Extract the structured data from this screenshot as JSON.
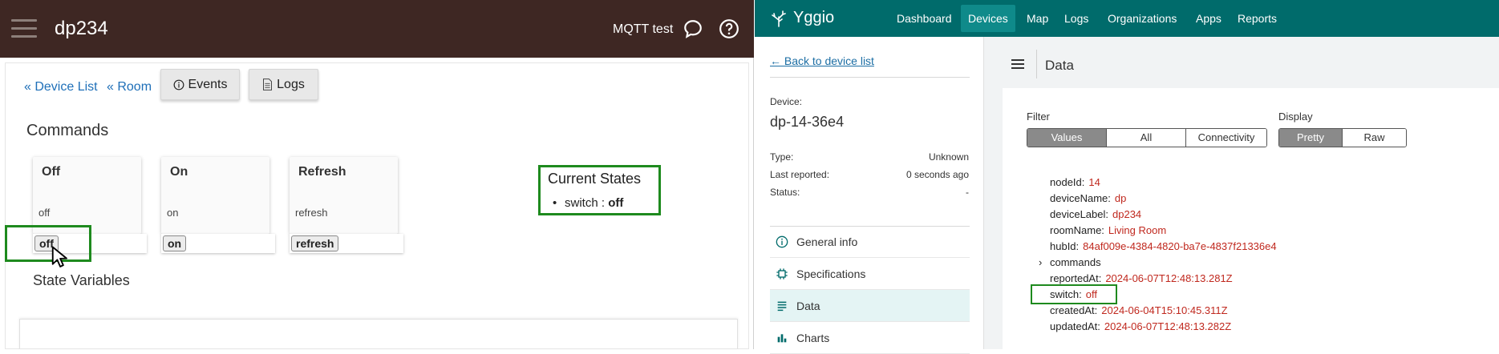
{
  "left_app": {
    "title": "dp234",
    "connection_label": "MQTT test",
    "nav": {
      "device_list": "« Device List",
      "room": "« Room"
    },
    "buttons": {
      "events": "Events",
      "logs": "Logs"
    },
    "commands_title": "Commands",
    "commands": [
      {
        "name": "Off",
        "description": "off",
        "button": "off"
      },
      {
        "name": "On",
        "description": "on",
        "button": "on"
      },
      {
        "name": "Refresh",
        "description": "refresh",
        "button": "refresh"
      }
    ],
    "current_states": {
      "title": "Current States",
      "items": [
        {
          "key": "switch",
          "sep": " : ",
          "value": "off"
        }
      ]
    },
    "state_variables_title": "State Variables",
    "icons": {
      "menu": "hamburger-menu-icon",
      "chat": "chat-bubble-icon",
      "help": "help-circle-icon",
      "events": "info-icon",
      "logs": "document-icon",
      "cursor": "mouse-pointer-icon"
    },
    "colors": {
      "topbar": "#3e2723",
      "link": "#1e6fb8",
      "highlight": "#1e8a1e"
    }
  },
  "right_app": {
    "brand": "Yggio",
    "nav_items": [
      "Dashboard",
      "Devices",
      "Map",
      "Logs",
      "Organizations",
      "Apps",
      "Reports"
    ],
    "active_nav": "Devices",
    "back_link": "← Back to device list",
    "device_label": "Device:",
    "device_name": "dp-14-36e4",
    "info": [
      {
        "key": "Type:",
        "value": "Unknown"
      },
      {
        "key": "Last reported:",
        "value": "0 seconds ago"
      },
      {
        "key": "Status:",
        "value": "-"
      }
    ],
    "side_menu": [
      {
        "label": "General info",
        "icon": "info-icon"
      },
      {
        "label": "Specifications",
        "icon": "chip-icon"
      },
      {
        "label": "Data",
        "icon": "data-lines-icon",
        "active": true
      },
      {
        "label": "Charts",
        "icon": "bar-chart-icon"
      }
    ],
    "data_header": "Data",
    "filter": {
      "label": "Filter",
      "options": [
        "Values",
        "All",
        "Connectivity"
      ],
      "selected": "Values"
    },
    "display": {
      "label": "Display",
      "options": [
        "Pretty",
        "Raw"
      ],
      "selected": "Pretty"
    },
    "data_rows": [
      {
        "key": "nodeId:",
        "value": "14"
      },
      {
        "key": "deviceName:",
        "value": "dp"
      },
      {
        "key": "deviceLabel:",
        "value": "dp234"
      },
      {
        "key": "roomName:",
        "value": "Living Room"
      },
      {
        "key": "hubId:",
        "value": "84af009e-4384-4820-ba7e-4837f21336e4"
      },
      {
        "key": "commands",
        "value": ""
      },
      {
        "key": "reportedAt:",
        "value": "2024-06-07T12:48:13.281Z"
      },
      {
        "key": "switch:",
        "value": "off"
      },
      {
        "key": "createdAt:",
        "value": "2024-06-04T15:10:45.311Z"
      },
      {
        "key": "updatedAt:",
        "value": "2024-06-07T12:48:13.282Z"
      }
    ],
    "colors": {
      "topbar": "#006b6b",
      "active_nav": "#0f8a8a",
      "value": "#c0281e",
      "highlight": "#1e8a1e"
    }
  }
}
